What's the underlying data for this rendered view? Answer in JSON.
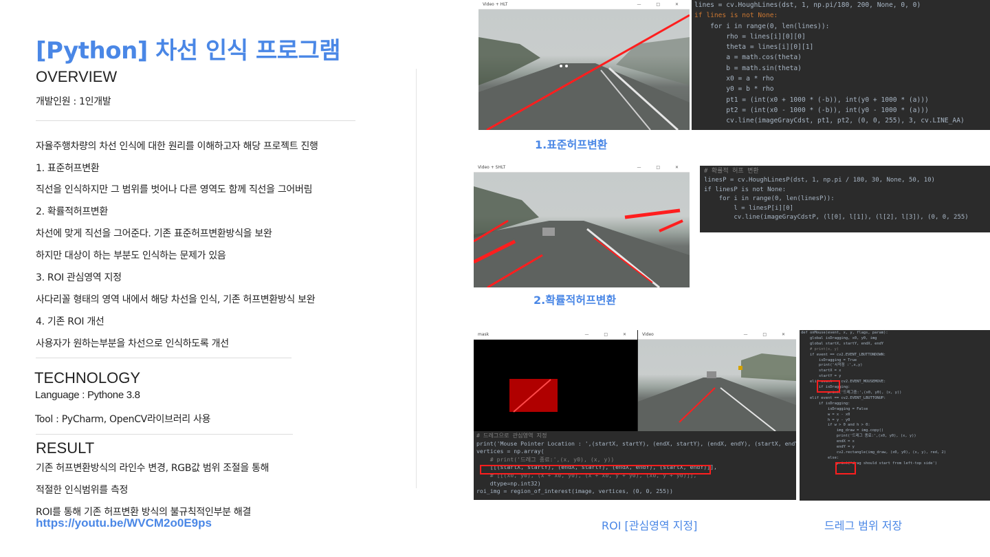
{
  "title": "[Python] 차선 인식 프로그램",
  "overview": {
    "heading": "OVERVIEW",
    "developers": "개발인원 : 1인개발",
    "lines": [
      "자율주행차량의 차선 인식에 대한 원리를 이해하고자 해당 프로젝트 진행",
      "1. 표준허프변환",
      "직선을 인식하지만 그 범위를 벗어나 다른 영역도 함께 직선을 그어버림",
      "2. 확률적허프변환",
      "차선에 맞게  직선을 그어준다. 기존 표준허프변환방식을 보완",
      "하지만 대상이 하는 부분도 인식하는 문제가 있음",
      "3. ROI 관심영역 지정",
      "사다리꼴 형태의 영역 내에서 해당 차선을 인식, 기존 허프변환방식 보완",
      "4. 기존 ROI 개선",
      "사용자가 원하는부분을 차선으로 인식하도록 개선"
    ]
  },
  "technology": {
    "heading": "TECHNOLOGY",
    "language": "Language : Pythone 3.8",
    "tool": "Tool : PyCharm, OpenCV라이브러리 사용"
  },
  "result": {
    "heading": "RESULT",
    "lines": [
      "기존 허프변환방식의 라인수 변경, RGB값 범위 조절을 통해",
      "적절한 인식범위를 측정",
      "ROI를 통해 기존 허프변환 방식의 불규칙적인부분 해결"
    ],
    "link": "https://youtu.be/WVCM2o0E9ps"
  },
  "captions": {
    "standard": "1.표준허프변환",
    "probabilistic": "2.확률적허프변환",
    "roi": "ROI [관심영역 지정]",
    "drag": "드레그 범위 저장"
  },
  "windows": {
    "video_hlt": "Video + HLT",
    "video_shlt": "Video + SHLT",
    "mask": "mask",
    "video": "Video",
    "controls": "—  □  ✕"
  },
  "code1": [
    "lines = cv.HoughLines(dst, 1, np.pi/180, 200, None, 0, 0)",
    "if lines is not None:",
    "    for i in range(0, len(lines)):",
    "        rho = lines[i][0][0]",
    "        theta = lines[i][0][1]",
    "        a = math.cos(theta)",
    "        b = math.sin(theta)",
    "        x0 = a * rho",
    "        y0 = b * rho",
    "        pt1 = (int(x0 + 1000 * (-b)), int(y0 + 1000 * (a)))",
    "        pt2 = (int(x0 - 1000 * (-b)), int(y0 - 1000 * (a)))",
    "        cv.line(imageGrayCdst, pt1, pt2, (0, 0, 255), 3, cv.LINE_AA)"
  ],
  "code2": [
    "# 확률적 허프 변환",
    "linesP = cv.HoughLinesP(dst, 1, np.pi / 180, 30, None, 50, 10)",
    "if linesP is not None:",
    "    for i in range(0, len(linesP)):",
    "        l = linesP[i][0]",
    "        cv.line(imageGrayCdstP, (l[0], l[1]), (l[2], l[3]), (0, 0, 255)"
  ],
  "code3": [
    "# 드레그으로 관심영역 지정",
    "print('Mouse Pointer Location : ',(startX, startY), (endX, startY), (endX, endY), (startX, endY))",
    "vertices = np.array(",
    "    # print('드레그 종료:',(x, y0), (x, y))",
    "    [[(startX, startY), (endX, startY), (endX, endY), (startX, endY)]],",
    "    # [[(x0, y0), (x + x0, y0), (x + x0, y + y0), (x0, y + y0)]],",
    "    dtype=np.int32)",
    "roi_img = region_of_interest(image, vertices, (0, 0, 255))"
  ],
  "code4": [
    "def onMouse(event, x, y, flags, param):",
    "    global isDragging, x0, y0, img",
    "    global startX, startY, endX, endY",
    "    # print(x, y)",
    "",
    "    if event == cv2.EVENT_LBUTTONDOWN:",
    "        isDragging = True",
    "        print('시작점 :',x,y)",
    "        startX = x",
    "        startY = y",
    "    elif event == cv2.EVENT_MOUSEMOVE:",
    "        if isDragging:",
    "            print('드레그중:',(x0, y0), (x, y))",
    "    elif event == cv2.EVENT_LBUTTONUP:",
    "        if isDragging:",
    "            isDragging = False",
    "            w = x - x0",
    "            h = y - y0",
    "            if w > 0 and h > 0:",
    "                img_draw = img.copy()",
    "                print('드레그 종료:',(x0, y0), (x, y))",
    "                endX = x",
    "                endY = y",
    "                cv2.rectangle(img_draw, (x0, y0), (x, y), red, 2)",
    "",
    "            else:",
    "                print('drag should start from left-top side')"
  ]
}
